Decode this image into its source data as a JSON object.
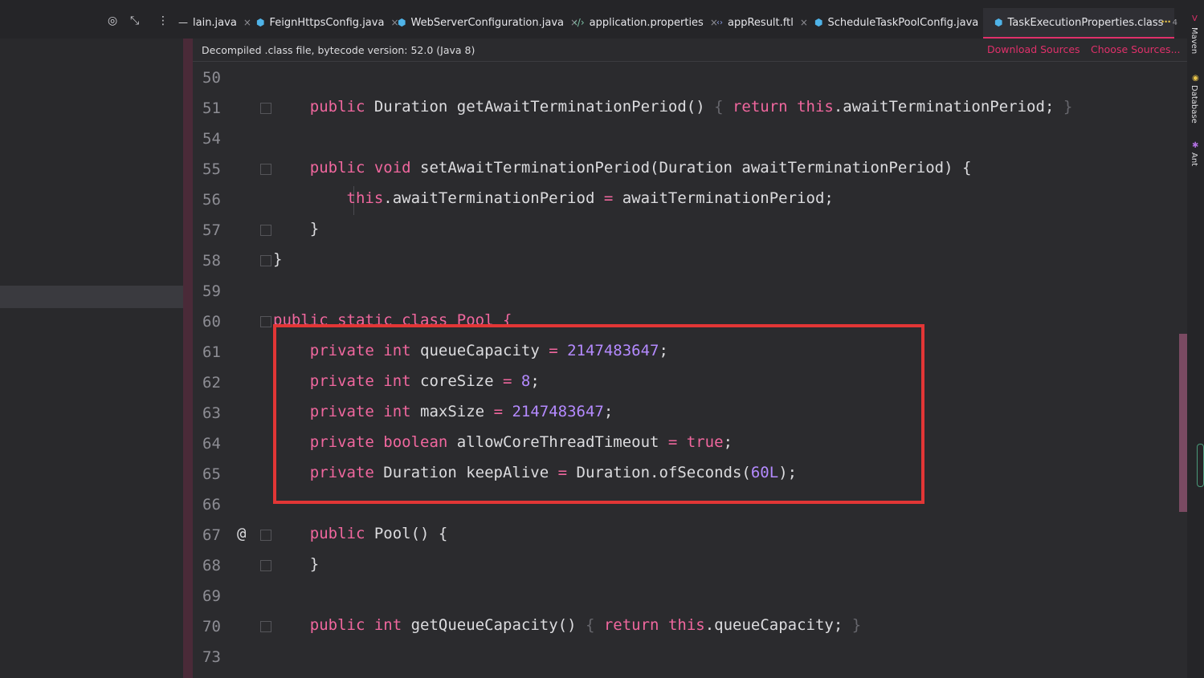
{
  "tabs": [
    {
      "label": "lain.java",
      "icon": "dash-icon",
      "close": "×"
    },
    {
      "label": "FeignHttpsConfig.java",
      "icon": "class-icon",
      "close": "×"
    },
    {
      "label": "WebServerConfiguration.java",
      "icon": "class-icon",
      "close": "×"
    },
    {
      "label": "application.properties",
      "icon": "properties-icon",
      "close": "×"
    },
    {
      "label": "appResult.ftl",
      "icon": "ftl-icon",
      "close": "×"
    },
    {
      "label": "ScheduleTaskPoolConfig.java",
      "icon": "class-icon",
      "close": "×"
    },
    {
      "label": "TaskExecutionProperties.class",
      "icon": "class-icon",
      "close": ""
    }
  ],
  "tab_overflow": {
    "label": "⋯",
    "count": "4"
  },
  "banner": {
    "text": "Decompiled .class file, bytecode version: 52.0 (Java 8)",
    "download_sources": "Download Sources",
    "choose_sources": "Choose Sources..."
  },
  "right_tools": {
    "maven": "Maven",
    "database": "Database",
    "ant": "Ant"
  },
  "gutter": {
    "line_numbers": [
      "50",
      "51",
      "54",
      "55",
      "56",
      "57",
      "58",
      "59",
      "60",
      "61",
      "62",
      "63",
      "64",
      "65",
      "66",
      "67",
      "68",
      "69",
      "70",
      "73"
    ],
    "at_marker": "@"
  },
  "code": {
    "l51": {
      "kw1": "public",
      "t1": " Duration getAwaitTerminationPeriod() ",
      "b1": "{",
      "kw2": " return",
      "t2": " ",
      "kw3": "this",
      "t3": ".awaitTerminationPeriod; ",
      "b2": "}"
    },
    "l55": {
      "kw1": "public",
      "kw2": " void",
      "t1": " setAwaitTerminationPeriod(Duration awaitTerminationPeriod) {"
    },
    "l56": {
      "kw1": "this",
      "t1": ".awaitTerminationPeriod ",
      "op": "=",
      "t2": " awaitTerminationPeriod;"
    },
    "l57": {
      "t1": "}"
    },
    "l58": {
      "t1": "}"
    },
    "l60": {
      "t1": "public static class Pool {"
    },
    "l61": {
      "kw1": "private",
      "kw2": " int",
      "t1": " queueCapacity ",
      "op": "=",
      "num": " 2147483647",
      "t2": ";"
    },
    "l62": {
      "kw1": "private",
      "kw2": " int",
      "t1": " coreSize ",
      "op": "=",
      "num": " 8",
      "t2": ";"
    },
    "l63": {
      "kw1": "private",
      "kw2": " int",
      "t1": " maxSize ",
      "op": "=",
      "num": " 2147483647",
      "t2": ";"
    },
    "l64": {
      "kw1": "private",
      "kw2": " boolean",
      "t1": " allowCoreThreadTimeout ",
      "op": "=",
      "kw3": " true",
      "t2": ";"
    },
    "l65": {
      "kw1": "private",
      "t1": " Duration keepAlive ",
      "op": "=",
      "t2": " Duration.ofSeconds(",
      "num": "60L",
      "t3": ");"
    },
    "l67": {
      "kw1": "public",
      "t1": " Pool() {"
    },
    "l68": {
      "t1": "}"
    },
    "l70": {
      "kw1": "public",
      "kw2": " int",
      "t1": " getQueueCapacity() ",
      "b1": "{",
      "kw3": " return",
      "t2": " ",
      "kw4": "this",
      "t3": ".queueCapacity; ",
      "b2": "}"
    }
  },
  "colors": {
    "accent": "#e0306a",
    "keyword": "#f0679e",
    "number": "#b48aff",
    "highlight_box": "#e23636"
  }
}
